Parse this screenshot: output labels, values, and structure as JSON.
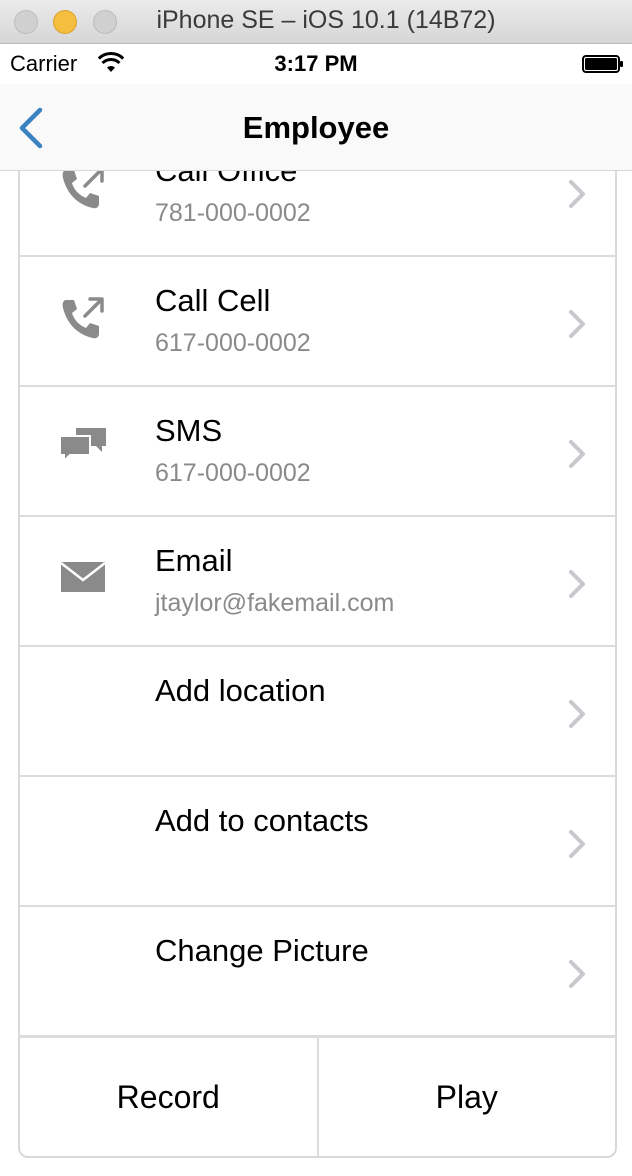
{
  "window": {
    "title": "iPhone SE – iOS 10.1 (14B72)"
  },
  "status_bar": {
    "carrier": "Carrier",
    "time": "3:17 PM"
  },
  "nav": {
    "title": "Employee"
  },
  "rows": [
    {
      "label": "Call Office",
      "sub": "781-000-0002",
      "icon": "phone-icon"
    },
    {
      "label": "Call Cell",
      "sub": "617-000-0002",
      "icon": "phone-icon"
    },
    {
      "label": "SMS",
      "sub": "617-000-0002",
      "icon": "chat-bubbles-icon"
    },
    {
      "label": "Email",
      "sub": "jtaylor@fakemail.com",
      "icon": "envelope-icon"
    },
    {
      "label": "Add location",
      "sub": "",
      "icon": ""
    },
    {
      "label": "Add to contacts",
      "sub": "",
      "icon": ""
    },
    {
      "label": "Change Picture",
      "sub": "",
      "icon": ""
    }
  ],
  "buttons": {
    "record": "Record",
    "play": "Play"
  },
  "colors": {
    "accent": "#3b82c4",
    "icon_gray": "#8a8a8a",
    "chevron_gray": "#c7c7cc",
    "separator": "#dcdcdc"
  }
}
